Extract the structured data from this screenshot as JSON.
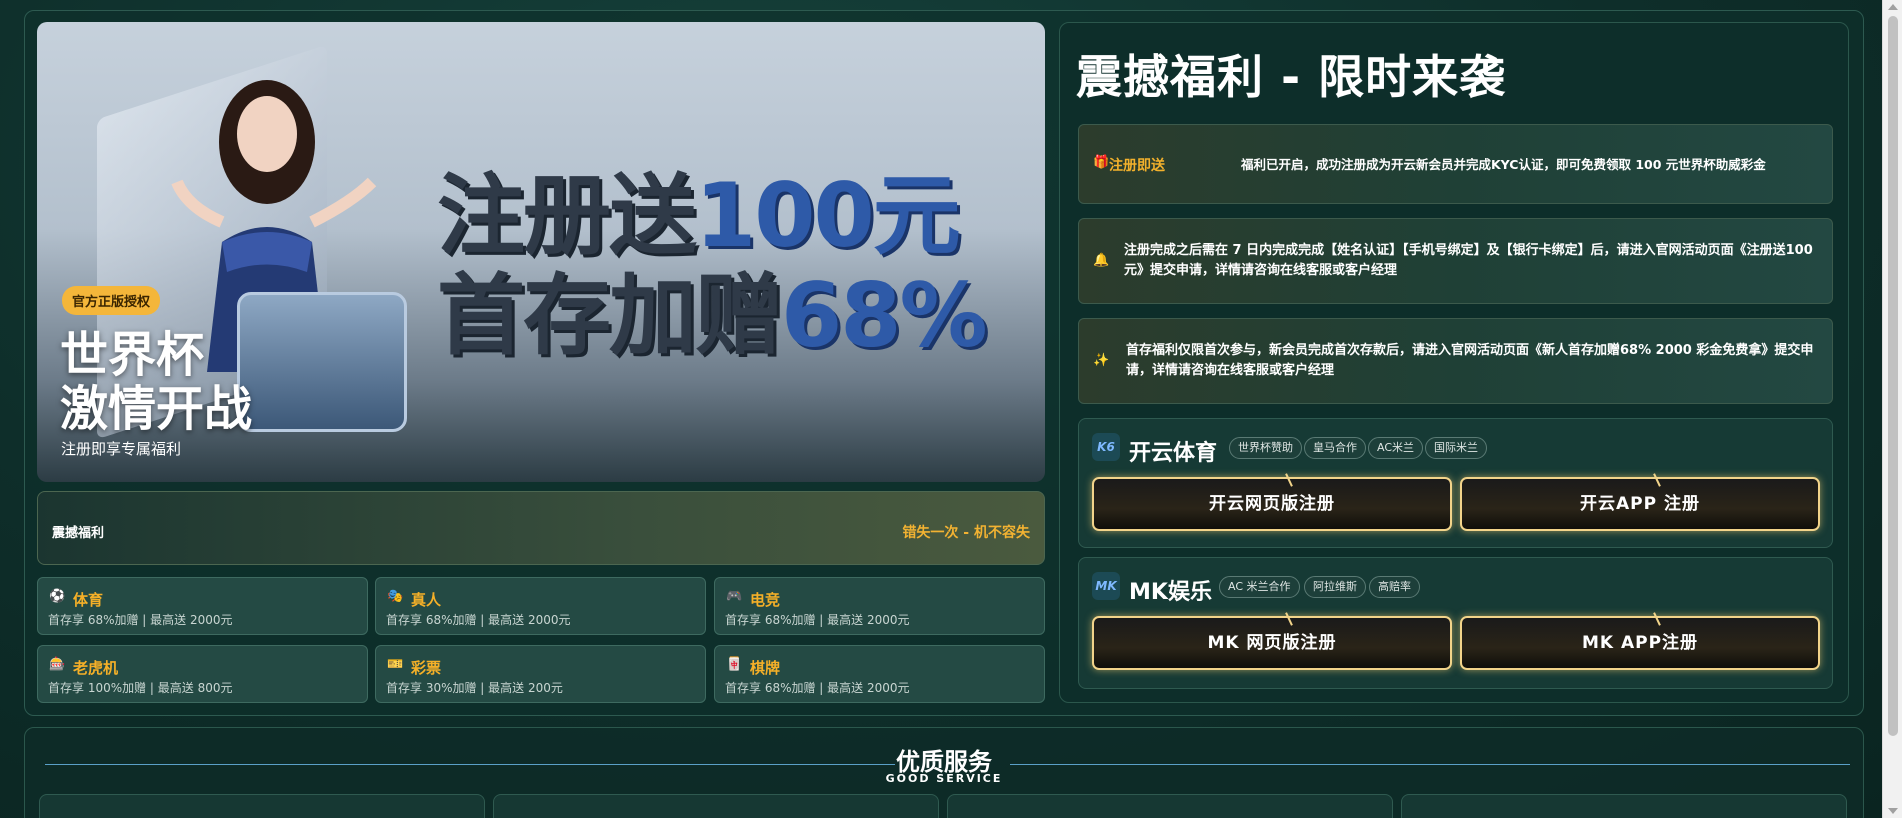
{
  "hero": {
    "line1_dark": "注册送",
    "line1_blue": "100元",
    "line2_dark": "首存加赠",
    "line2_blue": "68%",
    "badge": "官方正版授权",
    "title": "世界杯\n激情开战",
    "subtitle": "注册即享专属福利"
  },
  "promo_bar": {
    "left": "震撼福利",
    "right": "错失一次 - 机不容失"
  },
  "categories": [
    {
      "icon": "soccer-ball-icon",
      "glyph": "⚽",
      "name": "体育",
      "desc": "首存享 68%加赠 | 最高送 2000元"
    },
    {
      "icon": "mask-icon",
      "glyph": "🎭",
      "name": "真人",
      "desc": "首存享 68%加赠 | 最高送 2000元"
    },
    {
      "icon": "gamepad-icon",
      "glyph": "🎮",
      "name": "电竞",
      "desc": "首存享 68%加赠 | 最高送 2000元"
    },
    {
      "icon": "slot-machine-icon",
      "glyph": "🎰",
      "name": "老虎机",
      "desc": "首存享 100%加赠 | 最高送 800元"
    },
    {
      "icon": "ticket-icon",
      "glyph": "🎫",
      "name": "彩票",
      "desc": "首存享 30%加赠 | 最高送 200元"
    },
    {
      "icon": "mahjong-icon",
      "glyph": "🀄",
      "name": "棋牌",
      "desc": "首存享 68%加赠 | 最高送 2000元"
    }
  ],
  "panel": {
    "title": "震撼福利 - 限时来袭",
    "info": [
      {
        "icon": "gift-icon",
        "glyph": "🎁",
        "tag": "注册即送",
        "text": "福利已开启，成功注册成为开云新会员并完成KYC认证，即可免费领取 100 元世界杯助威彩金"
      },
      {
        "icon": "bell-icon",
        "glyph": "🔔",
        "tag": "",
        "text": "注册完成之后需在 7 日内完成完成【姓名认证】【手机号绑定】及【银行卡绑定】后，请进入官网活动页面《注册送100元》提交申请，详情请咨询在线客服或客户经理"
      },
      {
        "icon": "sparkle-icon",
        "glyph": "✨",
        "tag": "",
        "text": "首存福利仅限首次参与，新会员完成首次存款后，请进入官网活动页面《新人首存加赠68% 2000 彩金免费拿》提交申请，详情请咨询在线客服或客户经理"
      }
    ],
    "brands": [
      {
        "logo": "K6",
        "name": "开云体育",
        "chips": [
          "世界杯赞助",
          "皇马合作",
          "AC米兰",
          "国际米兰"
        ],
        "buttons": [
          "开云网页版注册",
          "开云APP 注册"
        ]
      },
      {
        "logo": "MK",
        "name": "MK娱乐",
        "chips": [
          "AC 米兰合作",
          "阿拉维斯",
          "高赔率"
        ],
        "buttons": [
          "MK 网页版注册",
          "MK APP注册"
        ]
      }
    ]
  },
  "service": {
    "title": "优质服务",
    "subtitle": "GOOD SERVICE"
  }
}
